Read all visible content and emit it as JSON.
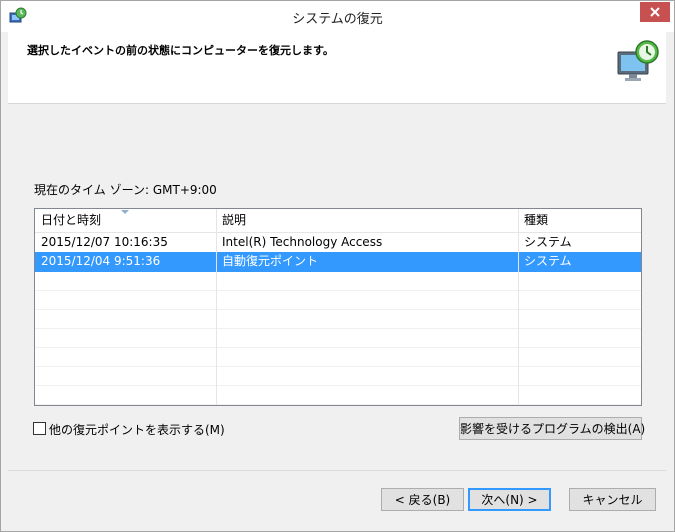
{
  "window": {
    "title": "システムの復元",
    "header_text": "選択したイベントの前の状態にコンピューターを復元します。"
  },
  "timezone_label": "現在のタイム ゾーン: GMT+9:00",
  "list": {
    "columns": [
      "日付と時刻",
      "説明",
      "種類"
    ],
    "rows": [
      {
        "date": "2015/12/07 10:16:35",
        "description": "Intel(R) Technology Access",
        "type": "システム",
        "selected": false
      },
      {
        "date": "2015/12/04 9:51:36",
        "description": "自動復元ポイント",
        "type": "システム",
        "selected": true
      }
    ]
  },
  "show_more_checkbox": {
    "label": "他の復元ポイントを表示する(M)",
    "checked": false
  },
  "buttons": {
    "detect": "影響を受けるプログラムの検出(A)",
    "back": "< 戻る(B)",
    "next": "次へ(N) >",
    "cancel": "キャンセル"
  },
  "colors": {
    "selection": "#3399ff",
    "close_button": "#c75050"
  },
  "icons": {
    "title": "system-restore-icon",
    "header": "restore-computer-icon",
    "close": "close-icon"
  }
}
